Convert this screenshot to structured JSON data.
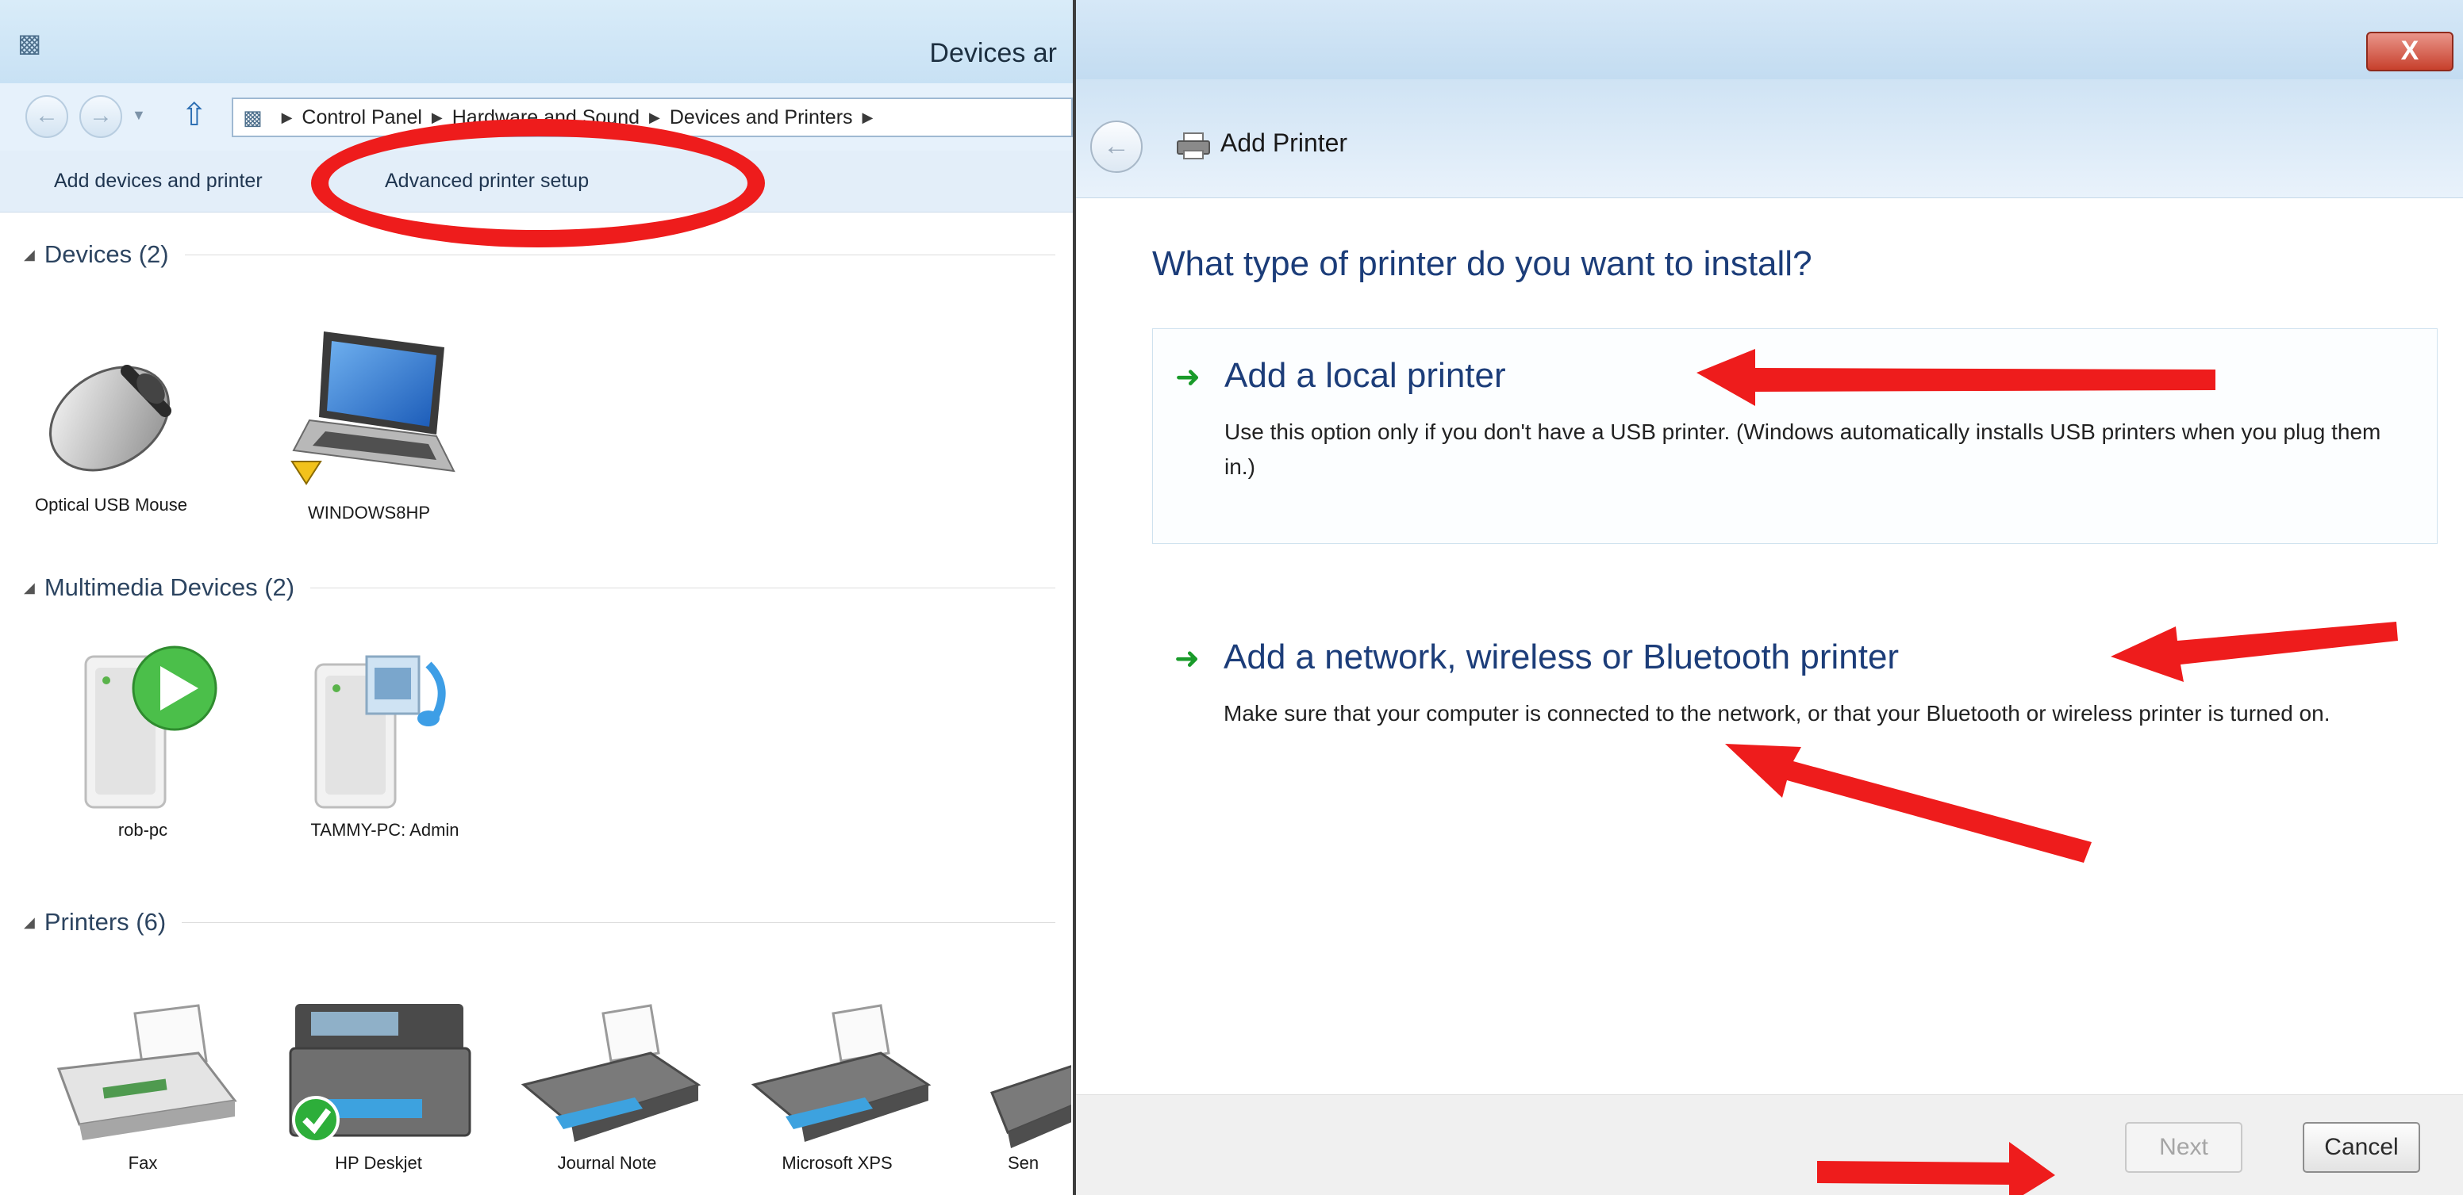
{
  "left_window": {
    "title": "Devices ar",
    "breadcrumb": [
      "Control Panel",
      "Hardware and Sound",
      "Devices and Printers"
    ],
    "command_bar": {
      "add_devices": "Add devices and printer",
      "advanced_setup": "Advanced printer setup"
    },
    "groups": {
      "devices": {
        "label": "Devices (2)",
        "items": [
          {
            "label": "Optical USB Mouse"
          },
          {
            "label": "WINDOWS8HP"
          }
        ]
      },
      "multimedia": {
        "label": "Multimedia Devices (2)",
        "items": [
          {
            "label": "rob-pc"
          },
          {
            "label": "TAMMY-PC: Admin"
          }
        ]
      },
      "printers": {
        "label": "Printers (6)",
        "items": [
          {
            "label": "Fax"
          },
          {
            "label": "HP Deskjet"
          },
          {
            "label": "Journal Note"
          },
          {
            "label": "Microsoft XPS"
          },
          {
            "label": "Sen"
          }
        ]
      }
    }
  },
  "dialog": {
    "title": "Add Printer",
    "close_label": "X",
    "question": "What type of printer do you want to install?",
    "options": [
      {
        "title": "Add a local printer",
        "description": "Use this option only if you don't have a USB printer. (Windows automatically installs USB printers when you plug them in.)"
      },
      {
        "title": "Add a network, wireless or Bluetooth printer",
        "description": "Make sure that your computer is connected to the network, or that your Bluetooth or wireless printer is turned on."
      }
    ],
    "buttons": {
      "next": "Next",
      "cancel": "Cancel"
    }
  },
  "icons": {
    "nav_back": "back-arrow-icon",
    "nav_forward": "forward-arrow-icon",
    "up": "up-arrow-icon",
    "option_arrow": "green-arrow-icon",
    "printer": "printer-icon",
    "warning": "warning-icon",
    "status_ok": "checkmark-icon"
  },
  "annotation_color": "#ee1c1c",
  "accent_color": "#1c3d79"
}
